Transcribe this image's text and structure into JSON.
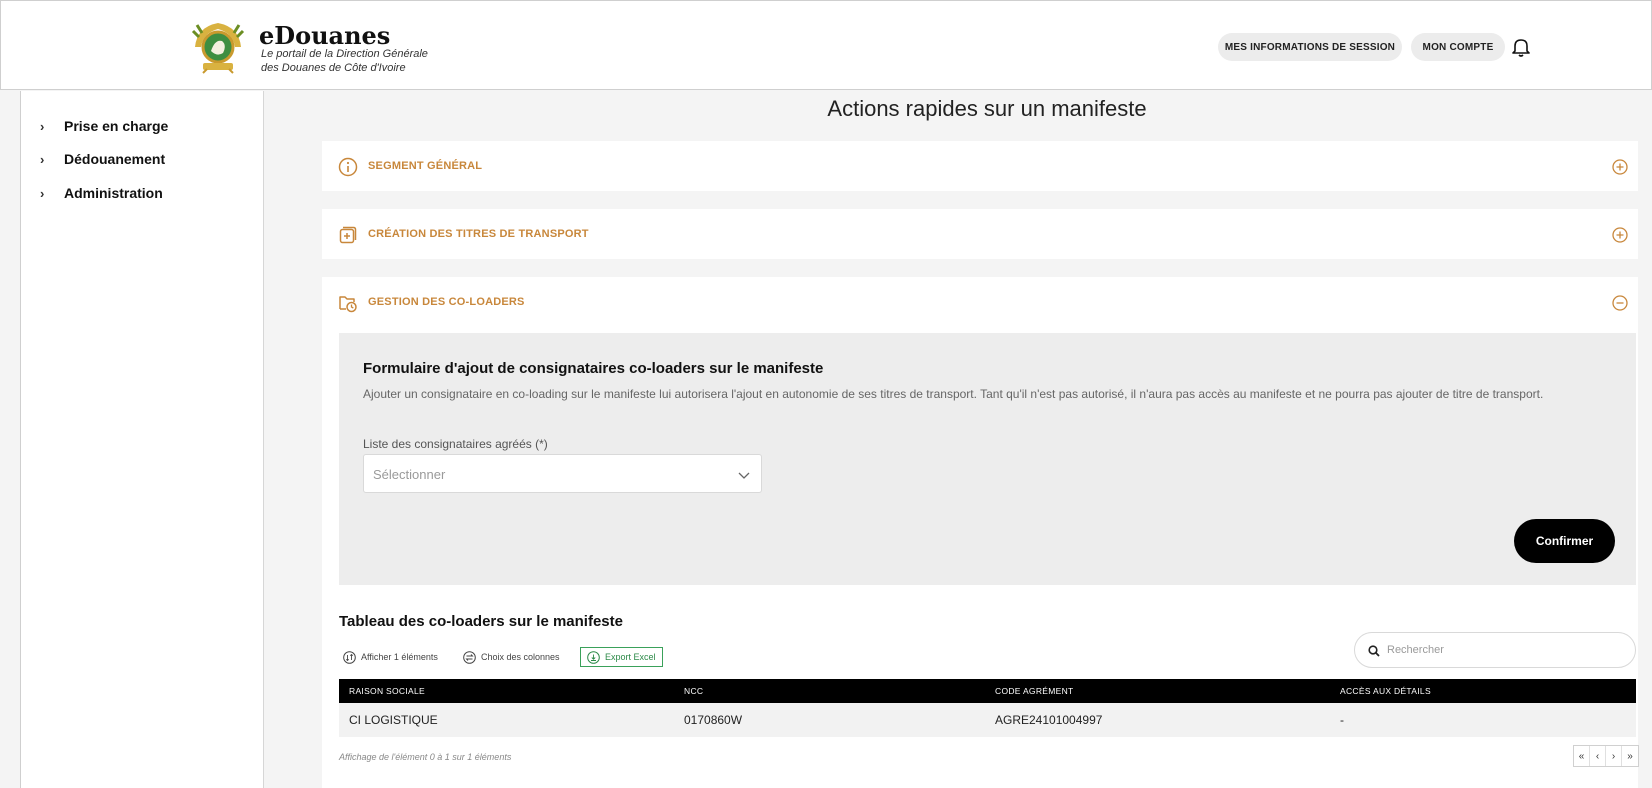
{
  "header": {
    "brand_title": "eDouanes",
    "brand_subtitle_line1": "Le portail de la Direction Générale",
    "brand_subtitle_line2": "des Douanes de Côte d'Ivoire",
    "session_button": "MES INFORMATIONS DE SESSION",
    "account_button": "MON COMPTE",
    "logo_icon": "coat-of-arms-logo",
    "bell_icon": "bell-icon"
  },
  "sidebar": {
    "items": [
      {
        "label": "Prise en charge"
      },
      {
        "label": "Dédouanement"
      },
      {
        "label": "Administration"
      }
    ]
  },
  "main": {
    "page_title": "Actions rapides sur un manifeste",
    "accent_color": "#c8873b",
    "panels": [
      {
        "label": "SEGMENT GÉNÉRAL",
        "state": "collapsed"
      },
      {
        "label": "CRÉATION DES TITRES DE TRANSPORT",
        "state": "collapsed"
      },
      {
        "label": "GESTION DES CO-LOADERS",
        "state": "expanded"
      }
    ],
    "form": {
      "title": "Formulaire d'ajout de consignataires co-loaders sur le manifeste",
      "description": "Ajouter un consignataire en co-loading sur le manifeste lui autorisera l'ajout en autonomie de ses titres de transport. Tant qu'il n'est pas autorisé, il n'aura pas accès au manifeste et ne pourra pas ajouter de titre de transport.",
      "field_label": "Liste des consignataires agréés (*)",
      "select_placeholder": "Sélectionner",
      "confirm_button": "Confirmer"
    },
    "table": {
      "title": "Tableau des co-loaders sur le manifeste",
      "tools": {
        "show_count": "Afficher 1 éléments",
        "columns": "Choix des colonnes",
        "export": "Export Excel"
      },
      "search_placeholder": "Rechercher",
      "columns": [
        "RAISON SOCIALE",
        "NCC",
        "CODE AGRÉMENT",
        "ACCÈS AUX DÉTAILS"
      ],
      "rows": [
        [
          "CI LOGISTIQUE",
          "0170860W",
          "AGRE24101004997",
          "-"
        ]
      ],
      "footer": "Affichage de l'élément 0 à 1 sur 1 éléments",
      "pager": [
        "«",
        "‹",
        "›",
        "»"
      ]
    }
  }
}
